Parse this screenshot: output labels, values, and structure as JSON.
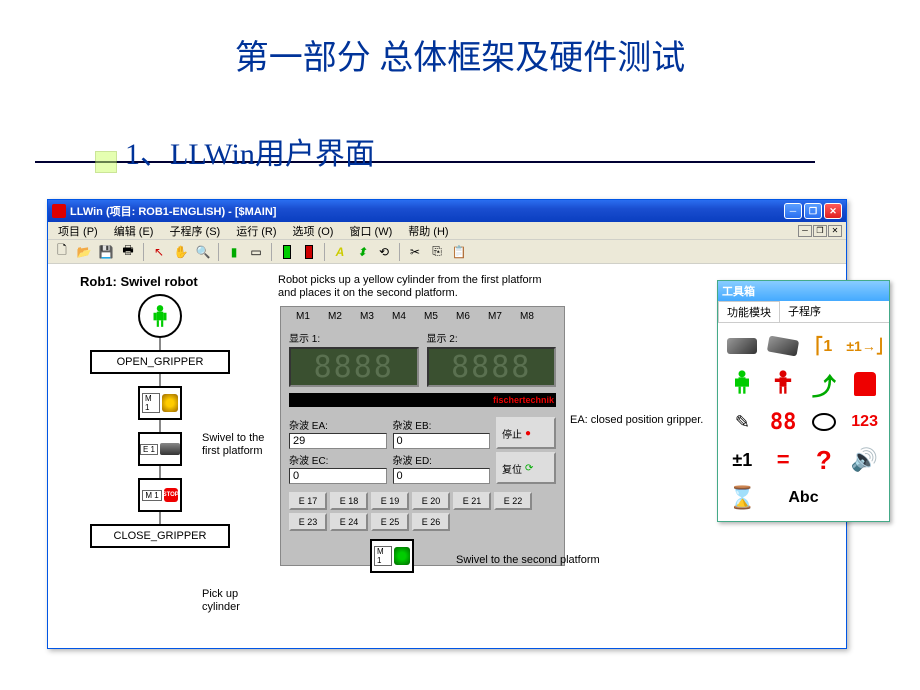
{
  "slide": {
    "title": "第一部分 总体框架及硬件测试",
    "subtitle": "1、LLWin用户界面"
  },
  "window": {
    "title": "LLWin  (项目: ROB1-ENGLISH)  - [$MAIN]",
    "menu": [
      "项目 (P)",
      "编辑 (E)",
      "子程序 (S)",
      "运行 (R)",
      "选项 (O)",
      "窗口 (W)",
      "帮助 (H)"
    ]
  },
  "canvas": {
    "rob_title": "Rob1: Swivel robot",
    "rob_desc": "Robot picks up a yellow cylinder from the first platform and places it on the second platform.",
    "ea_note": "EA: closed position gripper.",
    "open_gripper": "OPEN_GRIPPER",
    "close_gripper": "CLOSE_GRIPPER",
    "m1": "M 1",
    "e1": "E 1",
    "swivel1": "Swivel to the first platform",
    "pickup": "Pick up cylinder",
    "swivel2": "Swivel to the second platform"
  },
  "panel": {
    "motors": [
      "M1",
      "M2",
      "M3",
      "M4",
      "M5",
      "M6",
      "M7",
      "M8"
    ],
    "disp1": "显示 1:",
    "disp2": "显示 2:",
    "logo": "fischertechnik",
    "ea_label": "杂波 EA:",
    "eb_label": "杂波 EB:",
    "ec_label": "杂波 EC:",
    "ed_label": "杂波 ED:",
    "ea_val": "29",
    "eb_val": "0",
    "ec_val": "0",
    "ed_val": "0",
    "stop_label": "停止",
    "reset_label": "复位",
    "e_buttons": [
      "E 17",
      "E 18",
      "E 19",
      "E 20",
      "E 21",
      "E 22",
      "E 23",
      "E 24",
      "E 25",
      "E 26"
    ]
  },
  "toolbox": {
    "title": "工具箱",
    "tab1": "功能模块",
    "tab2": "子程序",
    "cnt1": "⎡1",
    "arr": "±1→⎦",
    "num123": "123",
    "pm1": "±1",
    "abc": "Abc"
  }
}
